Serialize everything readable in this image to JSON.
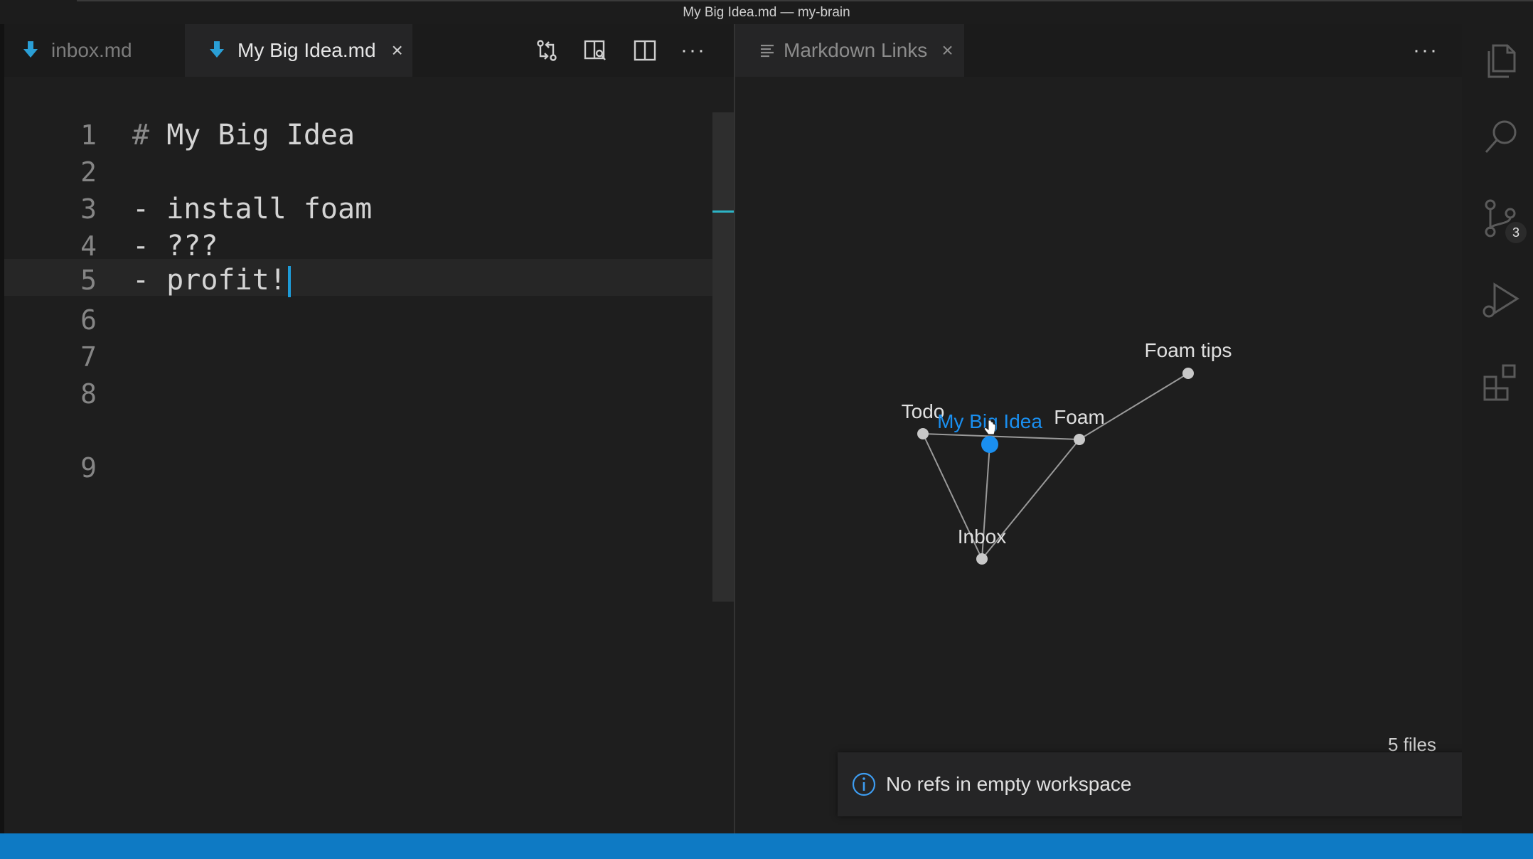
{
  "window_title": "My Big Idea.md — my-brain",
  "left_tabs": {
    "inbox": "inbox.md",
    "active": "My Big Idea.md",
    "close_glyph": "×"
  },
  "editor": {
    "line_numbers": [
      "1",
      "2",
      "3",
      "4",
      "5",
      "6",
      "7",
      "8",
      "9"
    ],
    "line1_hash": "#",
    "line1_text": "My Big Idea",
    "line3": "- install foam",
    "line4": "- ???",
    "line5": "- profit!"
  },
  "right_tab": {
    "label": "Markdown Links",
    "close_glyph": "×"
  },
  "more_actions_glyph": "···",
  "graph": {
    "nodes": [
      {
        "id": "foam-tips",
        "label": "Foam tips"
      },
      {
        "id": "todo",
        "label": "Todo"
      },
      {
        "id": "my-big-idea",
        "label": "My Big Idea",
        "selected": true
      },
      {
        "id": "foam",
        "label": "Foam"
      },
      {
        "id": "inbox",
        "label": "Inbox"
      }
    ],
    "edges": [
      [
        "todo",
        "foam"
      ],
      [
        "todo",
        "inbox"
      ],
      [
        "my-big-idea",
        "inbox"
      ],
      [
        "foam",
        "inbox"
      ],
      [
        "foam",
        "foam-tips"
      ]
    ],
    "accent_color": "#1a8ff0",
    "node_color": "#c8c8c8"
  },
  "files_count": "5 files",
  "notification": {
    "message": "No refs in empty workspace",
    "icon": "info-icon"
  },
  "activity_bar": {
    "icons": [
      "explorer-icon",
      "search-icon",
      "source-control-icon",
      "run-debug-icon",
      "extensions-icon"
    ],
    "source_control_badge": "3"
  },
  "colors": {
    "statusbar": "#0e7ac4",
    "cursor": "#1e9bd7",
    "markdown_icon": "#2a9fd6"
  }
}
